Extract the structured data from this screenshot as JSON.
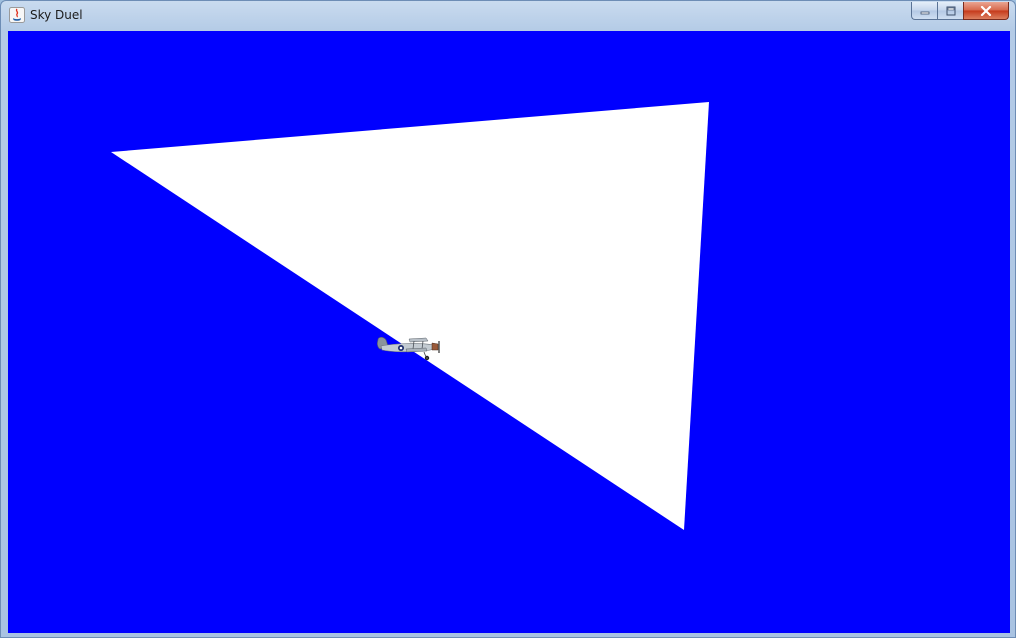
{
  "window": {
    "title": "Sky Duel",
    "icon": "java-icon",
    "controls": [
      "minimize-icon",
      "maximize-icon",
      "close-icon"
    ]
  },
  "game": {
    "sky_color": "#0000ff",
    "shape_color": "#ffffff",
    "shape": "triangle",
    "player": "biplane"
  }
}
